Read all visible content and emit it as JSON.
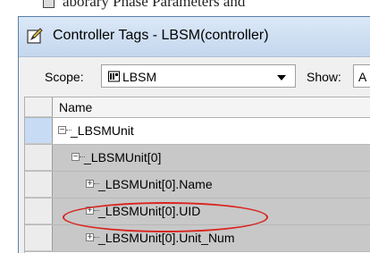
{
  "background": {
    "partial_text": "aborary Phase Parameters and"
  },
  "window": {
    "title": "Controller Tags - LBSM(controller)",
    "title_icon": "pencil-edit-icon"
  },
  "toolbar": {
    "scope_label": "Scope:",
    "scope_value": "LBSM",
    "scope_icon": "controller-icon",
    "show_label": "Show:",
    "show_value": "A"
  },
  "grid": {
    "header": {
      "name": "Name"
    },
    "rows": [
      {
        "label": "_LBSMUnit",
        "expander": "−",
        "level": 0
      },
      {
        "label": "_LBSMUnit[0]",
        "expander": "−",
        "level": 1
      },
      {
        "label": "_LBSMUnit[0].Name",
        "expander": "+",
        "level": 2
      },
      {
        "label": "_LBSMUnit[0].UID",
        "expander": "+",
        "level": 2
      },
      {
        "label": "_LBSMUnit[0].Unit_Num",
        "expander": "+",
        "level": 2
      }
    ]
  },
  "colors": {
    "highlight_ring": "#d9241e",
    "selected_row_header": "#c8dbf5",
    "row_gray": "#c8c8c8"
  }
}
